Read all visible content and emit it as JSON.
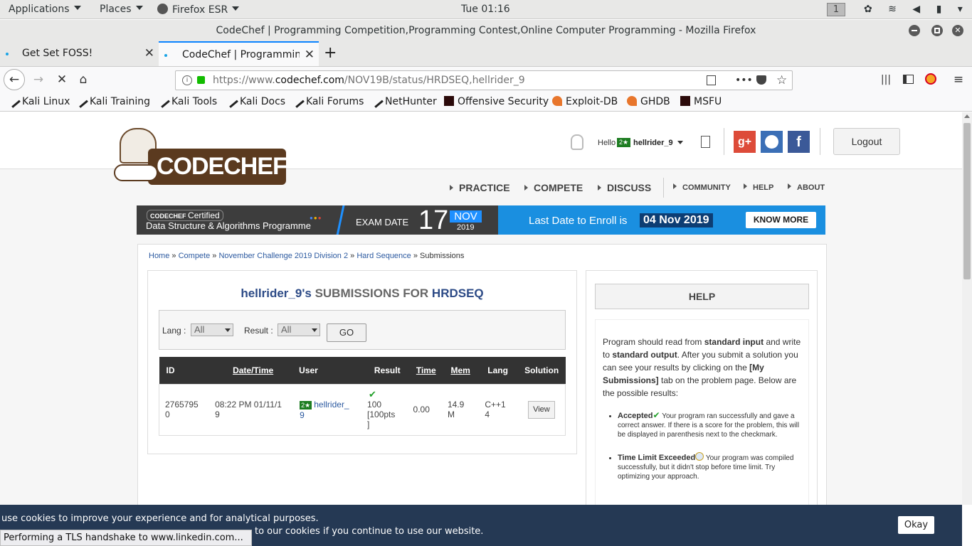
{
  "system": {
    "applications": "Applications",
    "places": "Places",
    "firefox": "Firefox ESR",
    "clock": "Tue 01:16",
    "workspace": "1"
  },
  "window": {
    "title": "CodeChef | Programming Competition,Programming Contest,Online Computer Programming - Mozilla Firefox"
  },
  "tabs": [
    {
      "label": "Get Set FOSS!"
    },
    {
      "label": "CodeChef | Programming"
    }
  ],
  "url": {
    "prefix": "https://www.",
    "domain": "codechef.com",
    "path": "/NOV19B/status/HRDSEQ,hellrider_9"
  },
  "bookmarks": [
    {
      "label": "Kali Linux",
      "icon": "kali-icon"
    },
    {
      "label": "Kali Training",
      "icon": "kali-icon"
    },
    {
      "label": "Kali Tools",
      "icon": "kali-icon"
    },
    {
      "label": "Kali Docs",
      "icon": "kali-icon"
    },
    {
      "label": "Kali Forums",
      "icon": "kali-icon"
    },
    {
      "label": "NetHunter",
      "icon": "kali-icon"
    },
    {
      "label": "Offensive Security",
      "icon": "offsec-icon"
    },
    {
      "label": "Exploit-DB",
      "icon": "exploitdb-icon"
    },
    {
      "label": "GHDB",
      "icon": "exploitdb-icon"
    },
    {
      "label": "MSFU",
      "icon": "offsec-icon"
    }
  ],
  "site": {
    "logo_text": "CODECHEF",
    "hello": "Hello",
    "rating_badge": "2★",
    "username": "hellrider_9",
    "logout": "Logout",
    "nav_main": [
      "PRACTICE",
      "COMPETE",
      "DISCUSS"
    ],
    "nav_sub": [
      "COMMUNITY",
      "HELP",
      "ABOUT"
    ]
  },
  "banner": {
    "brand": "CODECHEF",
    "certified": "Certified",
    "programme": "Data Structure & Algorithms Programme",
    "exam_date_label": "EXAM DATE",
    "day": "17",
    "month": "NOV",
    "year": "2019",
    "enroll_text": "Last Date to Enroll is",
    "enroll_date": "04 Nov 2019",
    "cta": "KNOW MORE"
  },
  "breadcrumb": {
    "home": "Home",
    "compete": "Compete",
    "contest": "November Challenge 2019 Division 2",
    "problem": "Hard Sequence",
    "current": "Submissions",
    "sep": "»"
  },
  "submissions": {
    "heading_user": "hellrider_9's",
    "heading_mid": "SUBMISSIONS FOR",
    "heading_problem": "HRDSEQ",
    "filter_lang_label": "Lang :",
    "filter_lang_value": "All",
    "filter_result_label": "Result :",
    "filter_result_value": "All",
    "go": "GO",
    "columns": [
      "ID",
      "Date/Time",
      "User",
      "Result",
      "Time",
      "Mem",
      "Lang",
      "Solution"
    ],
    "rows": [
      {
        "id_a": "2765795",
        "id_b": "0",
        "date_a": "08:22 PM 01/11/1",
        "date_b": "9",
        "badge": "2★",
        "user_a": "hellrider_",
        "user_b": "9",
        "result_a": "100",
        "result_b": "[100pts",
        "result_c": "]",
        "time": "0.00",
        "mem_a": "14.9",
        "mem_b": "M",
        "lang_a": "C++1",
        "lang_b": "4",
        "view": "View"
      }
    ]
  },
  "help": {
    "title": "HELP",
    "p1": "Program should read from",
    "p1b": "standard input",
    "p2": "and write to",
    "p2b": "standard output",
    "p3": ". After you submit a solution you can see your results by clicking on the",
    "p3b": "[My Submissions]",
    "p4": "tab on the problem page. Below are the possible results:",
    "accepted_title": "Accepted",
    "accepted_text": "Your program ran successfully and gave a correct answer. If there is a score for the problem, this will be displayed in parenthesis next to the checkmark.",
    "tle_title": "Time Limit Exceeded",
    "tle_text": "Your program was compiled successfully, but it didn't stop before time limit. Try optimizing your approach."
  },
  "cookie": {
    "line1": "use cookies to improve your experience and for analytical purposes.",
    "line2": "to our cookies if you continue to use our website.",
    "okay": "Okay"
  },
  "status": "Performing a TLS handshake to www.linkedin.com..."
}
